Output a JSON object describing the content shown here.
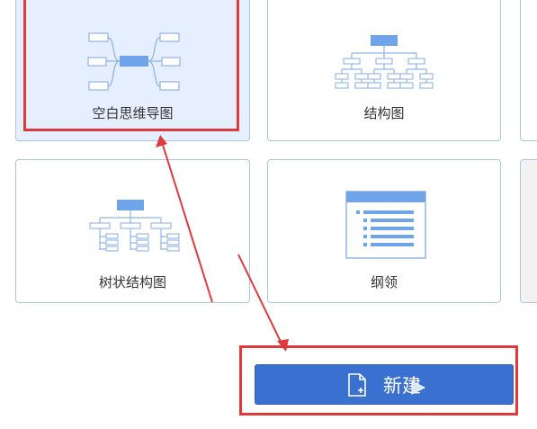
{
  "templates": [
    {
      "label": "空白思维导图",
      "selected": true
    },
    {
      "label": "结构图",
      "selected": false
    },
    {
      "label": "树状结构图",
      "selected": false
    },
    {
      "label": "纲领",
      "selected": false
    }
  ],
  "actions": {
    "new_button_label": "新建"
  },
  "icons": {
    "mindmap": "mind-map-icon",
    "structure": "structure-chart-icon",
    "tree": "tree-chart-icon",
    "outline": "outline-icon",
    "new_file": "new-file-icon",
    "cursor": "mouse-cursor-icon"
  },
  "colors": {
    "accent": "#3a70cf",
    "selected_card": "#e6efff",
    "card_border": "#a9c6e6",
    "annotation": "#e0393c",
    "diagram_fill": "#6fa3ea",
    "diagram_stroke": "#8fb5e6"
  }
}
